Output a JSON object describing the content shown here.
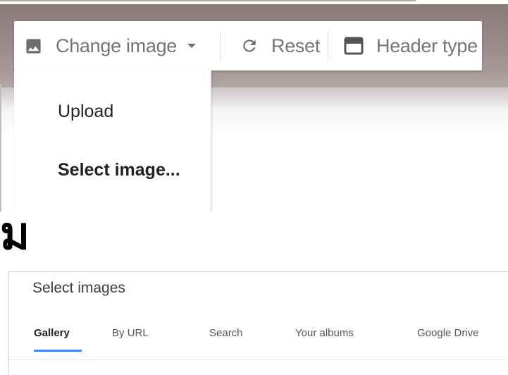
{
  "toolbar": {
    "change_image_label": "Change image",
    "reset_label": "Reset",
    "header_type_label": "Header type"
  },
  "dropdown": {
    "items": [
      {
        "label": "Upload"
      },
      {
        "label": "Select image..."
      }
    ]
  },
  "thai_text": "ม",
  "dialog": {
    "title": "Select images",
    "tabs": [
      {
        "label": "Gallery",
        "active": true
      },
      {
        "label": "By URL"
      },
      {
        "label": "Search"
      },
      {
        "label": "Your albums"
      },
      {
        "label": "Google Drive"
      }
    ]
  },
  "colors": {
    "banner": "#998988",
    "icon_gray": "#757575",
    "tab_accent": "#4285f4"
  }
}
